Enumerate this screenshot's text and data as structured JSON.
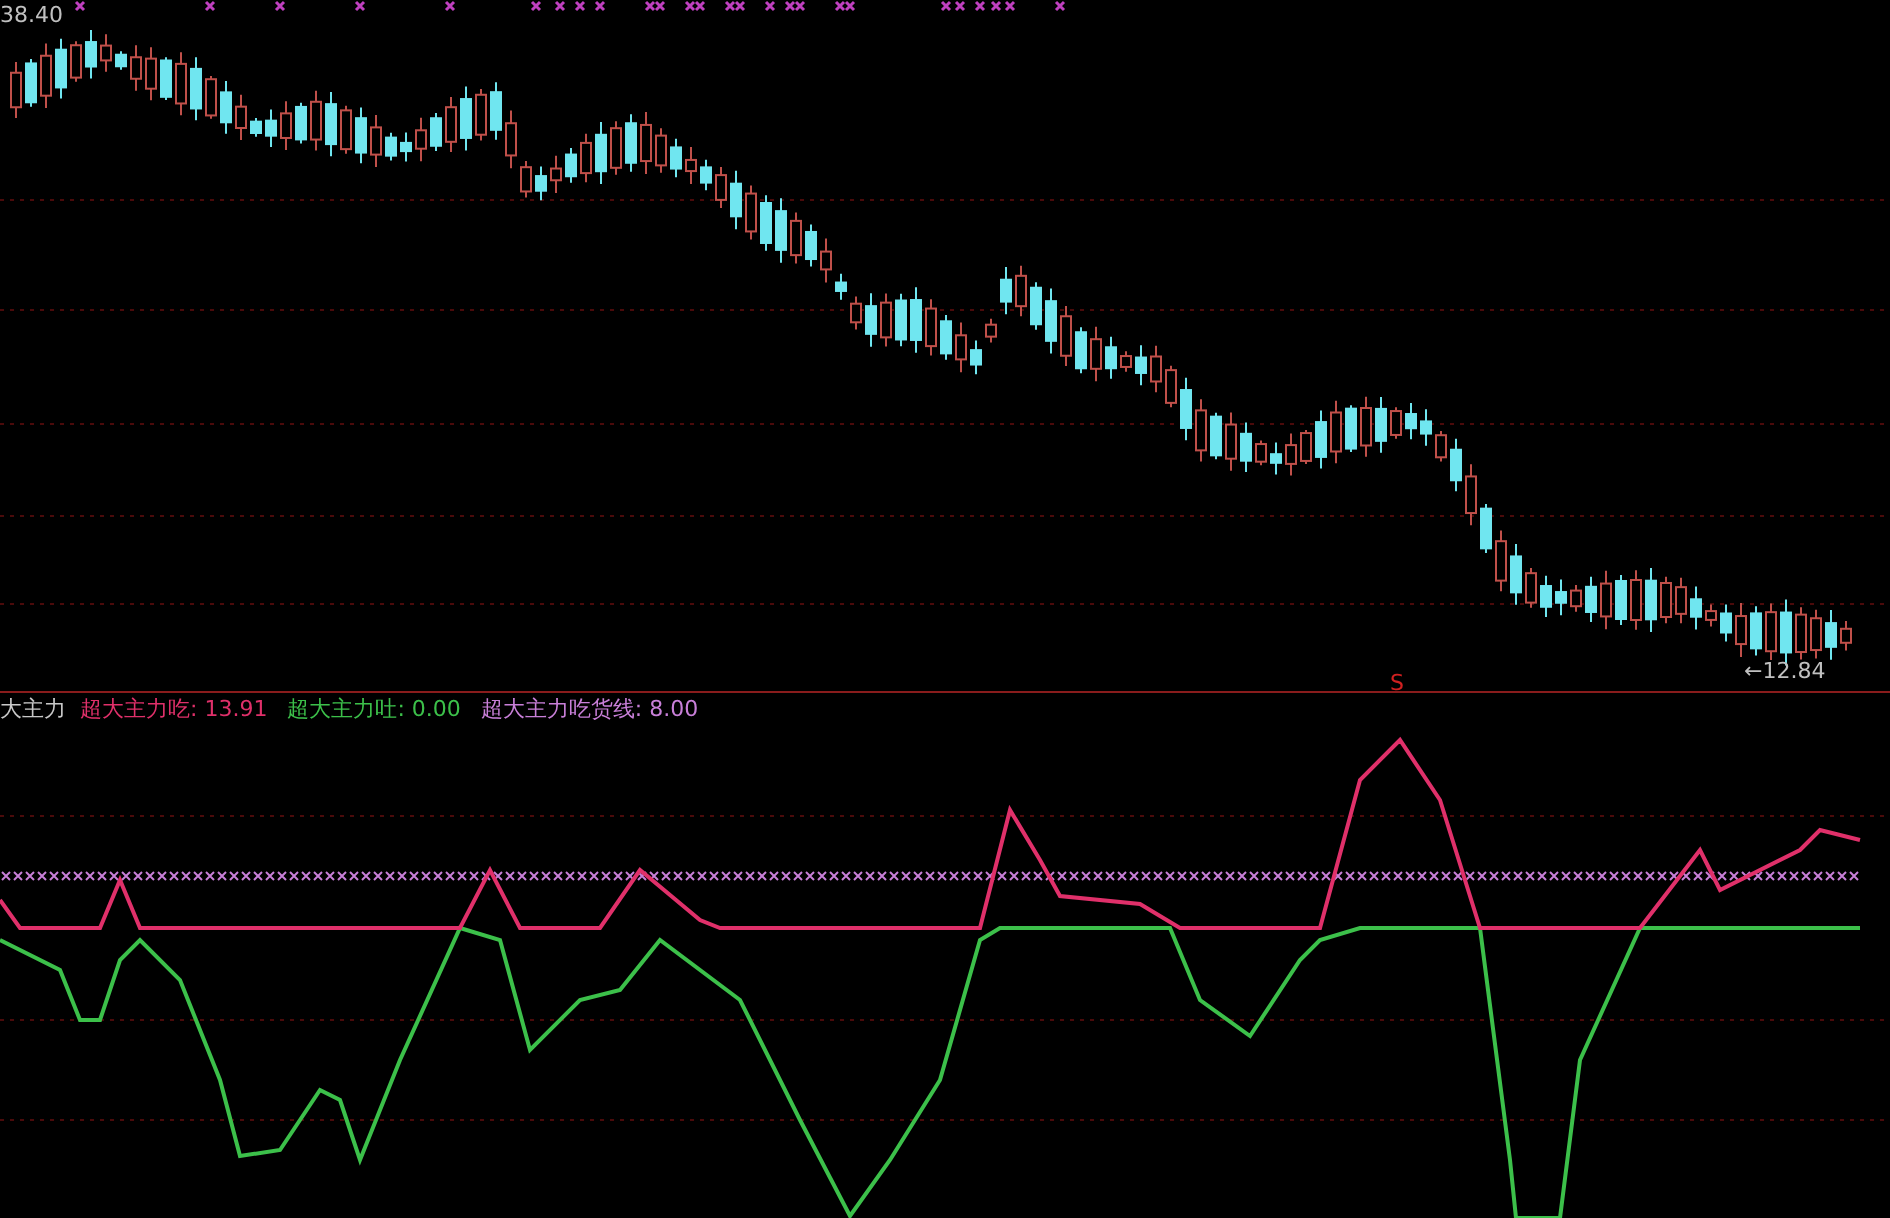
{
  "price_panel": {
    "high_label": "38.40",
    "low_label": "←12.84"
  },
  "signal_mark": "S",
  "indicator_panel": {
    "title": "大主力",
    "legend": [
      {
        "name": "超大主力吃:",
        "value": "13.91",
        "color": "#e0306a"
      },
      {
        "name": "超大主力吐:",
        "value": "0.00",
        "color": "#3cc04a"
      },
      {
        "name": "超大主力吃货线:",
        "value": "8.00",
        "color": "#c87fd8"
      }
    ]
  }
}
